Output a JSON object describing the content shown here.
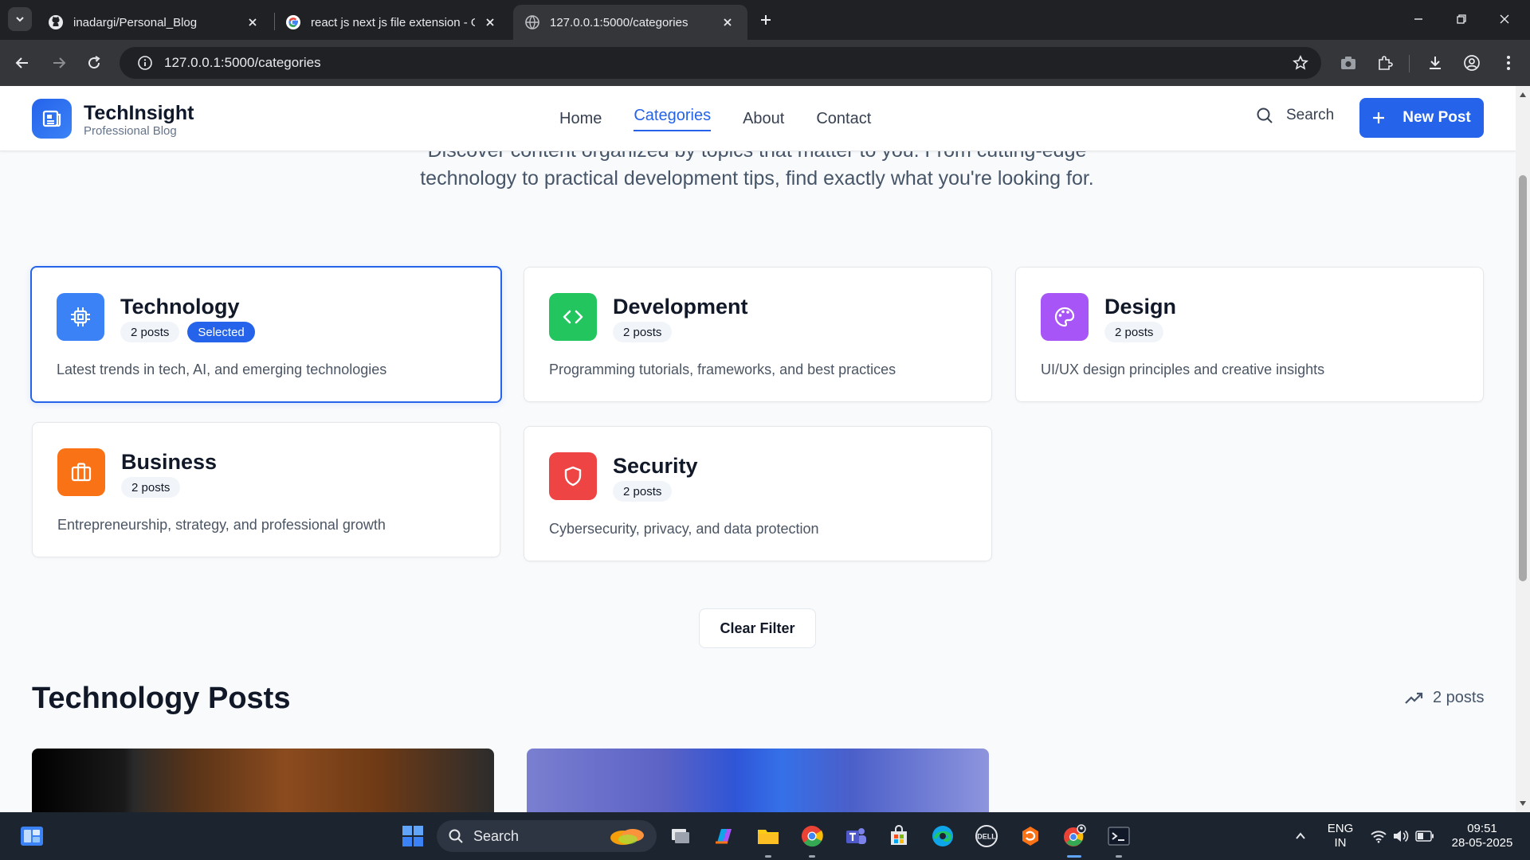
{
  "browser": {
    "tabs": [
      {
        "title": "inadargi/Personal_Blog",
        "icon": "github-icon"
      },
      {
        "title": "react js next js file extension - G",
        "icon": "google-icon"
      },
      {
        "title": "127.0.0.1:5000/categories",
        "icon": "globe-icon",
        "active": true
      }
    ],
    "url": "127.0.0.1:5000/categories"
  },
  "site": {
    "brand": {
      "name": "TechInsight",
      "tagline": "Professional Blog"
    },
    "nav": [
      {
        "label": "Home"
      },
      {
        "label": "Categories",
        "active": true
      },
      {
        "label": "About"
      },
      {
        "label": "Contact"
      }
    ],
    "search_label": "Search",
    "new_post_label": "New Post",
    "accent_color": "#2563eb"
  },
  "intro": "Discover content organized by topics that matter to you. From cutting-edge technology to practical development tips, find exactly what you're looking for.",
  "categories": [
    {
      "name": "Technology",
      "posts": "2 posts",
      "selected": true,
      "selected_label": "Selected",
      "description": "Latest trends in tech, AI, and emerging technologies",
      "icon": "cpu-chip-icon",
      "color": "#3b82f6"
    },
    {
      "name": "Development",
      "posts": "2 posts",
      "description": "Programming tutorials, frameworks, and best practices",
      "icon": "code-icon",
      "color": "#22c55e"
    },
    {
      "name": "Design",
      "posts": "2 posts",
      "description": "UI/UX design principles and creative insights",
      "icon": "palette-icon",
      "color": "#a855f7"
    },
    {
      "name": "Business",
      "posts": "2 posts",
      "description": "Entrepreneurship, strategy, and professional growth",
      "icon": "briefcase-icon",
      "color": "#f97316"
    },
    {
      "name": "Security",
      "posts": "2 posts",
      "description": "Cybersecurity, privacy, and data protection",
      "icon": "shield-icon",
      "color": "#ef4444"
    }
  ],
  "clear_filter_label": "Clear Filter",
  "posts_section": {
    "title": "Technology Posts",
    "count": "2 posts"
  },
  "taskbar": {
    "search_label": "Search",
    "language": "ENG",
    "region": "IN",
    "time": "09:51",
    "date": "28-05-2025"
  }
}
